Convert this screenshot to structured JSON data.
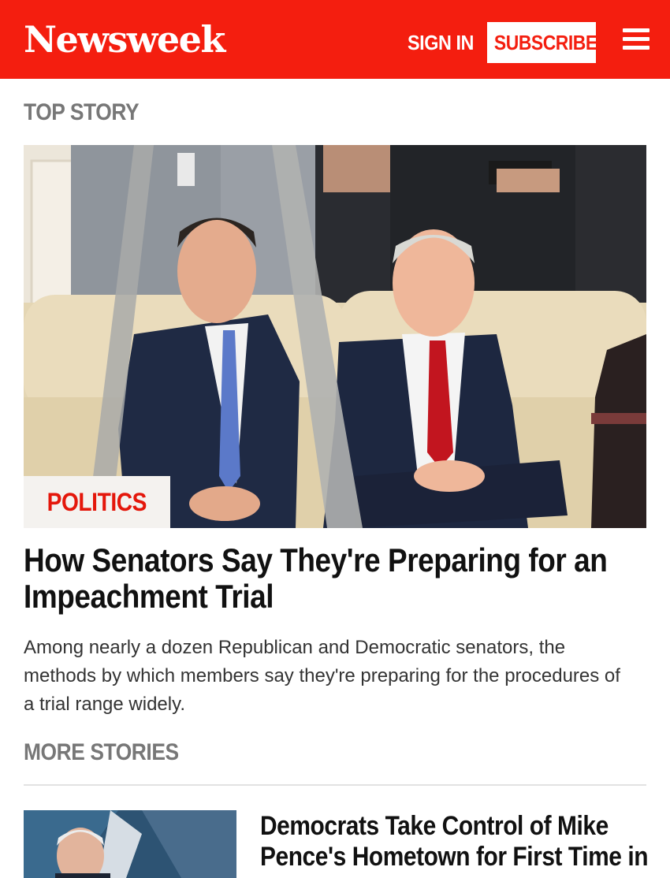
{
  "header": {
    "logo": "Newsweek",
    "sign_in": "SIGN IN",
    "subscribe": "SUBSCRIBE",
    "brand_color": "#f41e0f"
  },
  "top_story": {
    "section_label": "TOP STORY",
    "category": "POLITICS",
    "headline": "How Senators Say They're Preparing for an Impeachment Trial",
    "summary": "Among nearly a dozen Republican and Democratic senators, the methods by which members say they're preparing for the procedures of a trial range widely."
  },
  "more_stories": {
    "section_label": "MORE STORIES",
    "items": [
      {
        "title": "Democrats Take Control of Mike Pence's Hometown for First Time in"
      }
    ]
  }
}
